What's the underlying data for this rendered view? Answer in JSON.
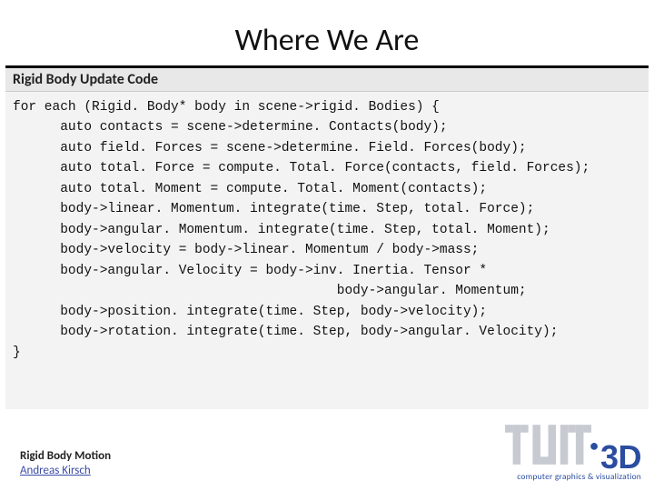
{
  "title": "Where We Are",
  "subhead": "Rigid Body Update Code",
  "code_lines": [
    "for each (Rigid. Body* body in scene->rigid. Bodies) {",
    "      auto contacts = scene->determine. Contacts(body);",
    "      auto field. Forces = scene->determine. Field. Forces(body);",
    "      auto total. Force = compute. Total. Force(contacts, field. Forces);",
    "      auto total. Moment = compute. Total. Moment(contacts);",
    "      body->linear. Momentum. integrate(time. Step, total. Force);",
    "      body->angular. Momentum. integrate(time. Step, total. Moment);",
    "      body->velocity = body->linear. Momentum / body->mass;",
    "      body->angular. Velocity = body->inv. Inertia. Tensor *",
    "                                         body->angular. Momentum;",
    "      body->position. integrate(time. Step, body->velocity);",
    "      body->rotation. integrate(time. Step, body->angular. Velocity);",
    "}"
  ],
  "footer": {
    "topic": "Rigid Body Motion",
    "author": "Andreas Kirsch"
  },
  "logo": {
    "brand": "3D",
    "tagline": "computer graphics & visualization"
  },
  "colors": {
    "accent": "#2b4da0",
    "band": "#e8e8e8",
    "codebg": "#f3f3f3"
  }
}
